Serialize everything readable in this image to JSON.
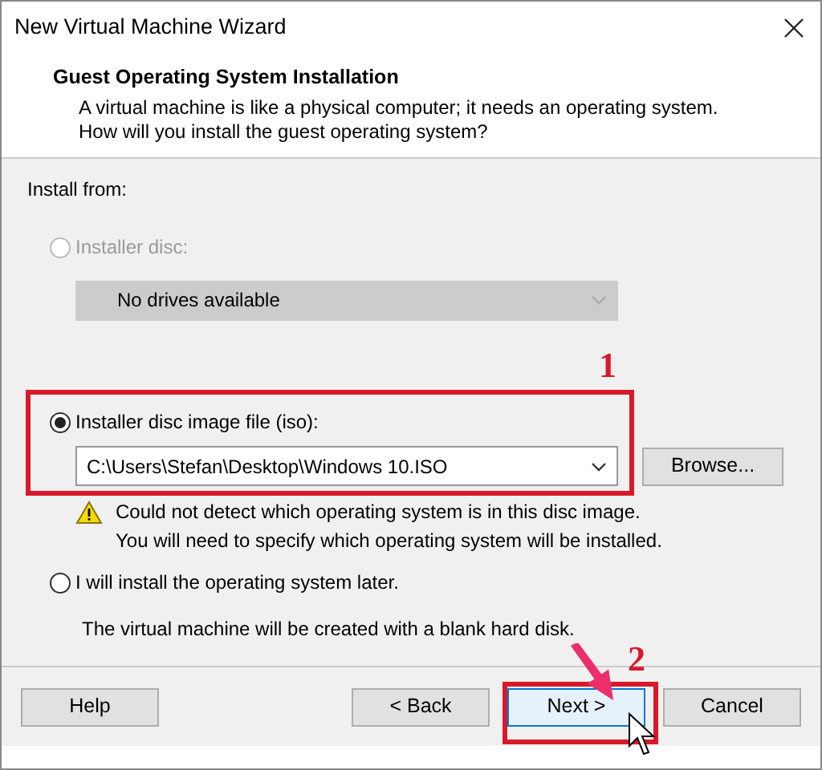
{
  "window": {
    "title": "New Virtual Machine Wizard"
  },
  "header": {
    "title": "Guest Operating System Installation",
    "description": "A virtual machine is like a physical computer; it needs an operating system. How will you install the guest operating system?"
  },
  "section_label": "Install from:",
  "options": [
    {
      "kind": "disc",
      "label": "Installer disc:",
      "selected": false,
      "disabled": true,
      "dropdown": "No drives available"
    },
    {
      "kind": "image",
      "label": "Installer disc image file (iso):",
      "selected": true,
      "disabled": false,
      "dropdown": "C:\\Users\\Stefan\\Desktop\\Windows 10.ISO",
      "browse": "Browse...",
      "warning": [
        "Could not detect which operating system is in this disc image.",
        "You will need to specify which operating system will be installed."
      ]
    },
    {
      "kind": "later",
      "label": "I will install the operating system later.",
      "selected": false,
      "disabled": false,
      "note": "The virtual machine will be created with a blank hard disk."
    }
  ],
  "buttons": [
    {
      "label": "Help",
      "focused": false
    },
    {
      "label": "< Back",
      "focused": false
    },
    {
      "label": "Next >",
      "focused": true
    },
    {
      "label": "Cancel",
      "focused": false
    }
  ],
  "annotations": [
    {
      "number": "1"
    },
    {
      "number": "2"
    }
  ]
}
